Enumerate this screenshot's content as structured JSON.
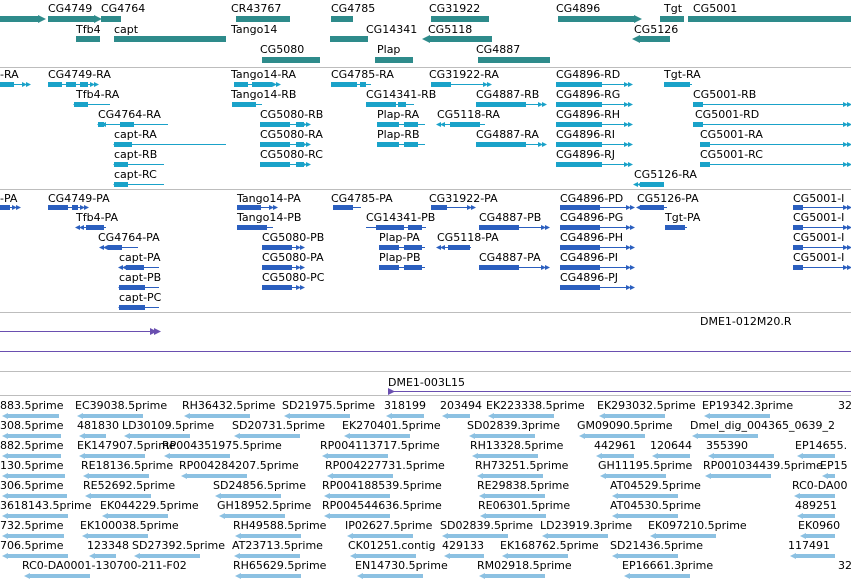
{
  "colors": {
    "gene": "#2e8b8b",
    "transcript": "#1aa2c9",
    "protein": "#2b5fbf",
    "clone": "#6a4fb0",
    "est": "#8cc1e2"
  },
  "tracks": {
    "genes": [
      "CG4749",
      "CG4764",
      "Tfb4",
      "capt",
      "CR43767",
      "Tango14",
      "CG5080",
      "CG4785",
      "CG14341",
      "Plap",
      "CG31922",
      "CG5118",
      "CG4887",
      "CG4896",
      "CG5126",
      "Tgt",
      "CG5001"
    ],
    "transcripts": [
      "-RA",
      "CG4749-RA",
      "Tfb4-RA",
      "CG4764-RA",
      "capt-RA",
      "capt-RB",
      "capt-RC",
      "Tango14-RA",
      "Tango14-RB",
      "CG5080-RB",
      "CG5080-RA",
      "CG5080-RC",
      "CG4785-RA",
      "CG14341-RB",
      "Plap-RA",
      "Plap-RB",
      "CG31922-RA",
      "CG5118-RA",
      "CG4887-RB",
      "CG4887-RA",
      "CG4896-RD",
      "CG4896-RG",
      "CG4896-RH",
      "CG4896-RI",
      "CG4896-RJ",
      "Tgt-RA",
      "CG5126-RA",
      "CG5001-RB",
      "CG5001-RD",
      "CG5001-RA",
      "CG5001-RC"
    ],
    "proteins": [
      "-PA",
      "CG4749-PA",
      "Tfb4-PA",
      "CG4764-PA",
      "capt-PA",
      "capt-PB",
      "capt-PC",
      "Tango14-PA",
      "Tango14-PB",
      "CG5080-PB",
      "CG5080-PA",
      "CG5080-PC",
      "CG4785-PA",
      "CG14341-PB",
      "Plap-PA",
      "Plap-PB",
      "CG31922-PA",
      "CG5118-PA",
      "CG4887-PB",
      "CG4887-PA",
      "CG4896-PD",
      "CG4896-PG",
      "CG4896-PH",
      "CG4896-PI",
      "CG4896-PJ",
      "CG5126-PA",
      "Tgt-PA",
      "CG5001-I",
      "CG5001-I",
      "CG5001-I",
      "CG5001-I"
    ],
    "clones": [
      "DME1-012M20.R",
      "DME1-003L15"
    ],
    "ests": [
      "883.5prime",
      "EC39038.5prime",
      "RH36432.5prime",
      "SD21975.5prime",
      "318199",
      "203494",
      "EK223338.5prime",
      "EK293032.5prime",
      "EP19342.3prime",
      "32",
      "308.5prime",
      "481830",
      "LD30109.5prime",
      "SD20731.5prime",
      "EK270401.5prime",
      "SD02839.3prime",
      "GM09090.5prime",
      "Dmel_dig_004365_0639_2",
      "882.5prime",
      "EK147907.5prime",
      "RP004351975.5prime",
      "RP004113717.5prime",
      "RH13328.5prime",
      "442961",
      "120644",
      "355390",
      "EP14655.",
      "130.5prime",
      "RE18136.5prime",
      "RP004284207.5prime",
      "RP004227731.5prime",
      "RH73251.5prime",
      "GH11195.5prime",
      "RP001034439.5prime",
      "EP15",
      "306.5prime",
      "RE52692.5prime",
      "SD24856.5prime",
      "RP004188539.5prime",
      "RE29838.5prime",
      "AT04529.5prime",
      "RC0-DA00",
      "3618143.5prime",
      "EK044229.5prime",
      "GH18952.5prime",
      "RP004544636.5prime",
      "RE06301.5prime",
      "AT04530.5prime",
      "489251",
      "732.5prime",
      "EK100038.5prime",
      "RH49588.5prime",
      "IP02627.5prime",
      "SD02839.5prime",
      "LD23919.3prime",
      "EK097210.5prime",
      "EK0960",
      "706.5prime",
      "123348",
      "SD27392.5prime",
      "AT23713.5prime",
      "CK01251.contig",
      "429133",
      "EK168762.5prime",
      "SD21436.5prime",
      "117491",
      "RC0-DA0001-130700-211-F02",
      "RH65629.5prime",
      "EN14730.5prime",
      "RM02918.5prime",
      "EP16661.3prime",
      "32"
    ]
  }
}
